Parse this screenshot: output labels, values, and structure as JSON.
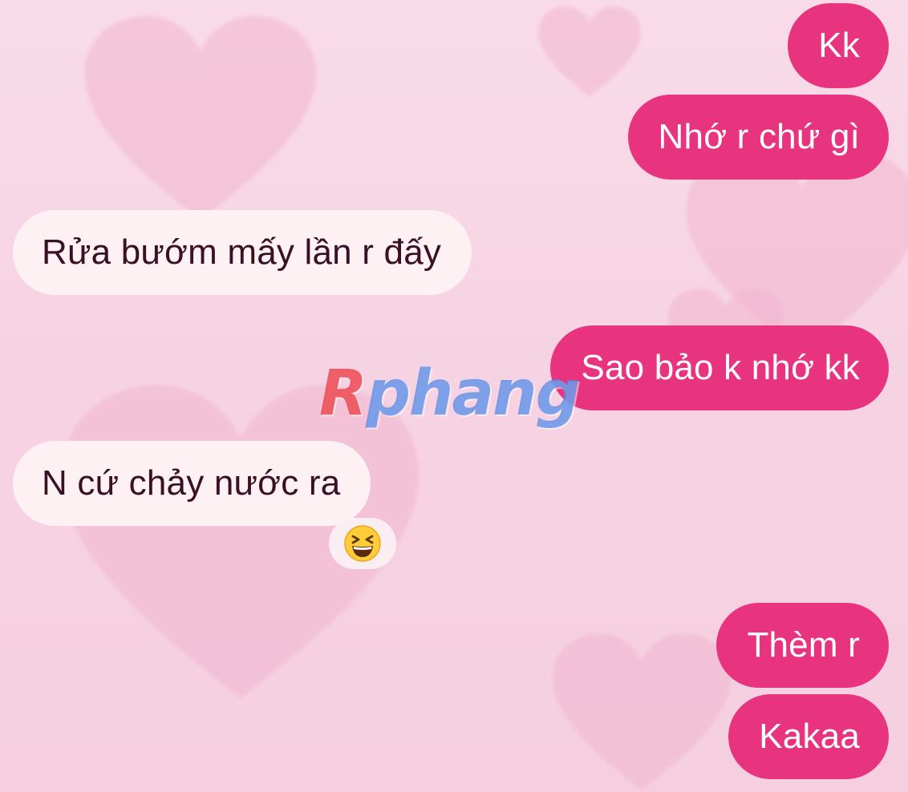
{
  "messages": [
    {
      "side": "out",
      "text": "Kk"
    },
    {
      "side": "out",
      "text": "Nhớ r chứ gì"
    },
    {
      "side": "in",
      "text": "Rửa bướm mấy lần r đấy"
    },
    {
      "side": "out",
      "text": "Sao bảo k nhớ kk"
    },
    {
      "side": "in",
      "text": "N cứ chảy nước ra",
      "reaction": "grinning-squinting-face-emoji"
    },
    {
      "side": "out",
      "text": "Thèm r"
    },
    {
      "side": "out",
      "text": "Kakaa"
    }
  ],
  "watermark": {
    "first": "R",
    "rest": "phang"
  },
  "colors": {
    "outgoing_bubble": "#e8347f",
    "incoming_bubble": "#fdf1f3",
    "background": "#f7d6e5"
  }
}
